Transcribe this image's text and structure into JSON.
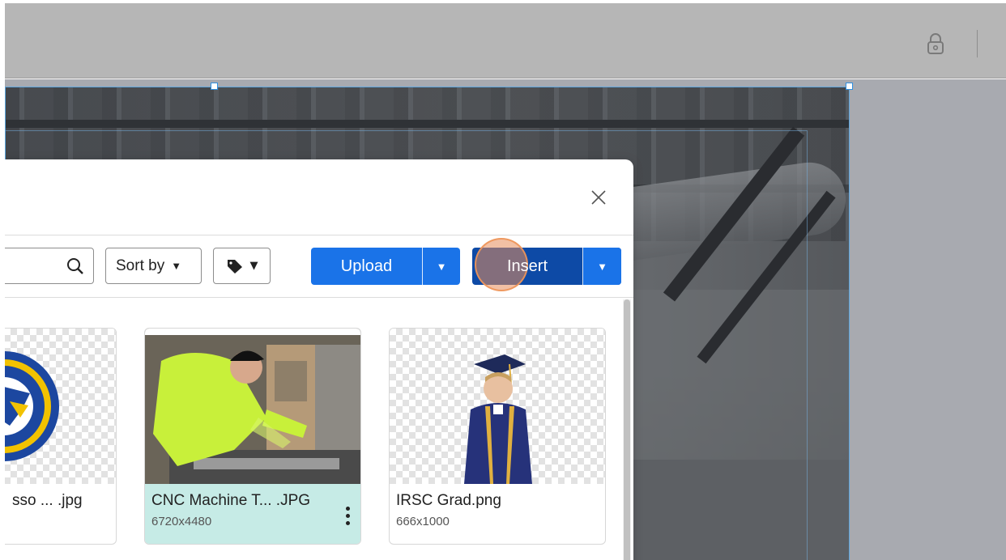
{
  "toolbar": {
    "icons": [
      "lock-icon"
    ]
  },
  "modal": {
    "close_icon": "close-icon",
    "search": {
      "value": "",
      "icon": "search-icon"
    },
    "sort_label": "Sort by",
    "tag_filter_icon": "tag-icon",
    "upload_label": "Upload",
    "insert_label": "Insert",
    "colors": {
      "upload_bg": "#1a73e8",
      "insert_bg": "#0d4aa6",
      "selected_card_bg": "#c6ebe6"
    },
    "images": [
      {
        "name": "sso ... .jpg",
        "dims": ""
      },
      {
        "name": "CNC Machine T... .JPG",
        "dims": "6720x4480",
        "selected": true
      },
      {
        "name": "IRSC Grad.png",
        "dims": "666x1000"
      }
    ]
  }
}
